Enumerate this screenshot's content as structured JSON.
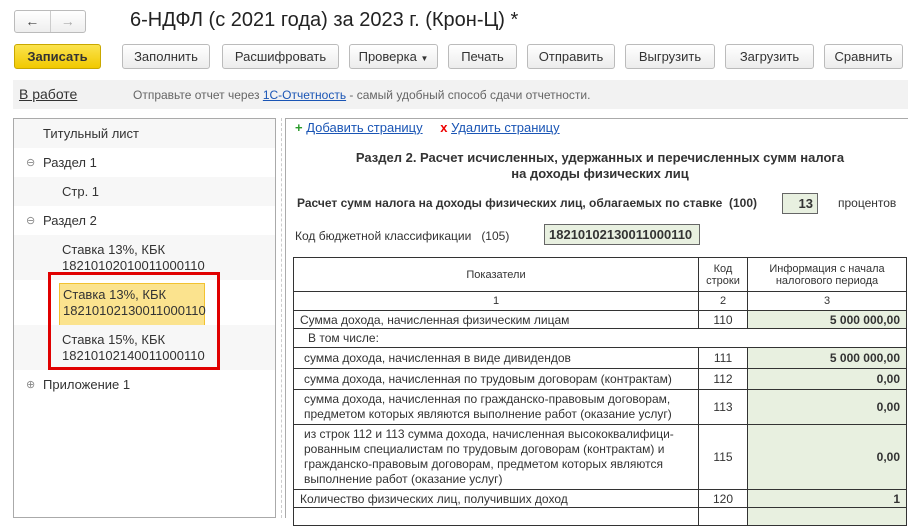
{
  "window": {
    "title": "6-НДФЛ (с 2021 года) за 2023 г. (Крон-Ц) *",
    "back": "←",
    "forward": "→"
  },
  "toolbar": {
    "save": "Записать",
    "fill": "Заполнить",
    "decode": "Расшифровать",
    "check": "Проверка",
    "print": "Печать",
    "send": "Отправить",
    "export": "Выгрузить",
    "import": "Загрузить",
    "compare": "Сравнить"
  },
  "status": {
    "state": "В работе",
    "msg_before": "Отправьте отчет через ",
    "link": "1С-Отчетность",
    "msg_after": " - самый удобный способ сдачи отчетности."
  },
  "tree": {
    "items": [
      {
        "label": "Титульный лист"
      },
      {
        "label": "Раздел 1",
        "toggle": "⊖"
      },
      {
        "label": "Стр. 1"
      },
      {
        "label": "Раздел 2",
        "toggle": "⊖"
      },
      {
        "line1": "Ставка 13%, КБК",
        "line2": "18210102010011000110"
      },
      {
        "line1": "Ставка 13%, КБК",
        "line2": "18210102130011000110",
        "selected": true
      },
      {
        "line1": "Ставка 15%, КБК",
        "line2": "18210102140011000110"
      },
      {
        "label": "Приложение 1",
        "toggle": "⊕"
      }
    ]
  },
  "page_actions": {
    "add": "Добавить страницу",
    "add_icon": "+",
    "remove": "Удалить страницу",
    "remove_icon": "x"
  },
  "section": {
    "title1": "Раздел 2. Расчет исчисленных, удержанных и перечисленных сумм налога",
    "title2": "на доходы физических лиц",
    "rate_label": "Расчет сумм налога на доходы физических лиц, облагаемых по ставке",
    "rate_code": "(100)",
    "rate_value": "13",
    "rate_unit": "процентов",
    "kbk_label": "Код бюджетной классификации",
    "kbk_code": "(105)",
    "kbk_value": "18210102130011000110"
  },
  "table": {
    "headers": [
      "Показатели",
      "Код строки",
      "Информация с начала налогового периода"
    ],
    "numbers": [
      "1",
      "2",
      "3"
    ],
    "rows": [
      {
        "label": "Сумма дохода, начисленная физическим лицам",
        "code": "110",
        "value": "5 000 000,00"
      },
      {
        "label": "В том числе:"
      },
      {
        "label": "сумма дохода, начисленная в виде дивидендов",
        "code": "111",
        "value": "5 000 000,00"
      },
      {
        "label": "сумма дохода, начисленная по трудовым договорам (контрактам)",
        "code": "112",
        "value": "0,00"
      },
      {
        "label": "сумма дохода, начисленная по гражданско-правовым договорам, предметом которых являются выполнение работ (оказание услуг)",
        "code": "113",
        "value": "0,00"
      },
      {
        "label": "из строк 112 и 113 сумма дохода, начисленная высококвалифици-рованным специалистам по трудовым договорам (контрактам) и гражданско-правовым договорам, предметом которых являются выполнение работ (оказание услуг)",
        "code": "115",
        "value": "0,00"
      },
      {
        "label": "Количество физических лиц, получивших доход",
        "code": "120",
        "value": "1"
      }
    ]
  }
}
